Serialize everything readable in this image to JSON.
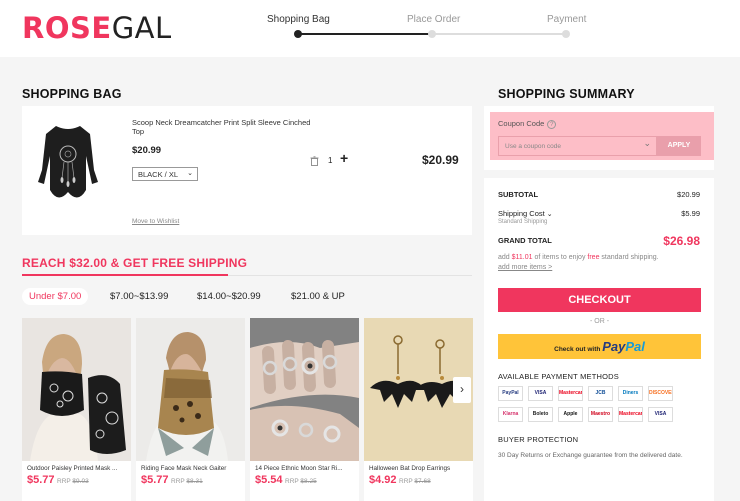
{
  "header": {
    "logo_part1": "ROSE",
    "logo_part2": "GAL",
    "steps": [
      {
        "label": "Shopping Bag",
        "active": true
      },
      {
        "label": "Place Order",
        "active": false
      },
      {
        "label": "Payment",
        "active": false
      }
    ]
  },
  "bag": {
    "title": "SHOPPING BAG",
    "item": {
      "name": "Scoop Neck Dreamcatcher Print Split Sleeve Cinched Top",
      "price": "$20.99",
      "variant": "BLACK / XL",
      "quantity": "1",
      "total": "$20.99",
      "wishlist_link": "Move to Wishlist"
    }
  },
  "free_shipping": {
    "title": "REACH $32.00 & GET FREE SHIPPING",
    "price_tabs": [
      "Under $7.00",
      "$7.00~$13.99",
      "$14.00~$20.99",
      "$21.00 & UP"
    ],
    "products": [
      {
        "name": "Outdoor Paisley Printed Mask ...",
        "price": "$5.77",
        "rrp_label": "RRP",
        "rrp": "$9.03"
      },
      {
        "name": "Riding Face Mask Neck Gaiter",
        "price": "$5.77",
        "rrp_label": "RRP",
        "rrp": "$8.31"
      },
      {
        "name": "14 Piece Ethnic Moon Star Ri...",
        "price": "$5.54",
        "rrp_label": "RRP",
        "rrp": "$8.25"
      },
      {
        "name": "Halloween Bat Drop Earrings",
        "price": "$4.92",
        "rrp_label": "RRP",
        "rrp": "$7.68"
      }
    ]
  },
  "summary": {
    "title": "SHOPPING SUMMARY",
    "coupon_label": "Coupon Code",
    "coupon_placeholder": "Use a coupon code",
    "apply_label": "APPLY",
    "subtotal_label": "SUBTOTAL",
    "subtotal": "$20.99",
    "shipping_label": "Shipping Cost",
    "shipping_method": "Standard Shipping",
    "shipping": "$5.99",
    "grand_total_label": "GRAND TOTAL",
    "grand_total": "$26.98",
    "note_prefix": "add",
    "note_amount": "$11.01",
    "note_mid": "of items to enjoy",
    "note_free": "free",
    "note_suffix": "standard shipping.",
    "add_more_link": "add more items >",
    "checkout_label": "CHECKOUT",
    "or_label": "- OR -",
    "paypal_prefix": "Check out with",
    "paypal_part1": "Pay",
    "paypal_part2": "Pal",
    "payment_methods_title": "AVAILABLE PAYMENT METHODS",
    "payment_methods": [
      "PayPal",
      "VISA",
      "Mastercard",
      "JCB",
      "Diners Club",
      "DISCOVER",
      "Klarna",
      "Boleto",
      "Apple Pay",
      "Maestro",
      "Mastercard",
      "VISA"
    ],
    "buyer_protection_title": "BUYER PROTECTION",
    "buyer_protection_text": "30 Day Returns or Exchange guarantee from the delivered date."
  },
  "colors": {
    "accent": "#f0365e",
    "paypal_yellow": "#ffc439"
  }
}
